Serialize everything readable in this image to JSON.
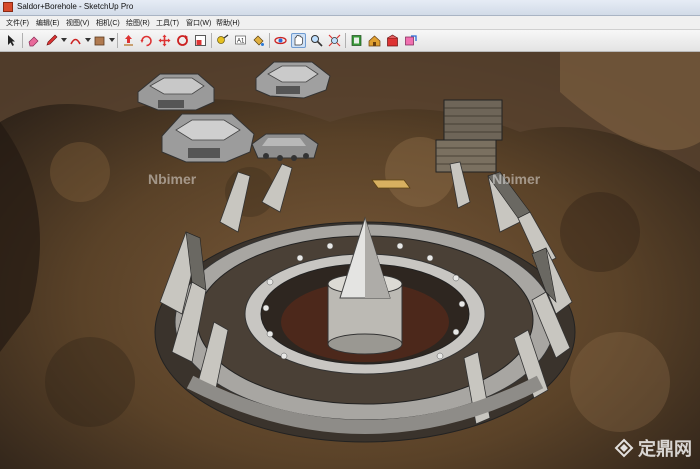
{
  "window": {
    "title": "Saldor+Borehole - SketchUp Pro"
  },
  "menu": {
    "items": [
      "文件(F)",
      "编辑(E)",
      "视图(V)",
      "相机(C)",
      "绘图(R)",
      "工具(T)",
      "窗口(W)",
      "帮助(H)"
    ]
  },
  "toolbar": {
    "buttons": [
      "select-icon",
      "eraser-icon",
      "pencil-icon",
      "arc-icon",
      "rectangle-icon",
      "push-pull-icon",
      "rotate-icon",
      "move-icon",
      "follow-me-icon",
      "scale-icon",
      "tape-measure-icon",
      "text-icon",
      "paint-bucket-icon",
      "orbit-icon",
      "pan-icon",
      "zoom-icon",
      "zoom-extents-icon",
      "components-icon",
      "warehouse-icon",
      "extensions-icon",
      "send-icon"
    ]
  },
  "watermarks": [
    "Nbimer",
    "Nbimer"
  ],
  "site_logo": {
    "text": "定鼎网"
  }
}
